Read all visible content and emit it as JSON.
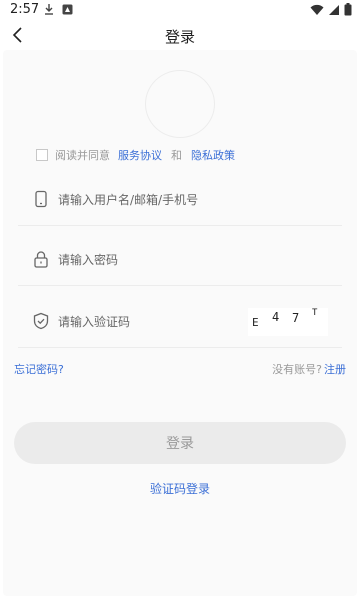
{
  "status_bar": {
    "time": "2:57",
    "left_icons": [
      "download-icon",
      "notification-app-icon"
    ],
    "right_icons": [
      "wifi-icon",
      "signal-icon",
      "battery-icon"
    ]
  },
  "header": {
    "title": "登录",
    "back_icon": "chevron-left-icon"
  },
  "agreement": {
    "prefix": "阅读并同意",
    "service_link": "服务协议",
    "and": "和",
    "privacy_link": "隐私政策",
    "checked": false
  },
  "fields": {
    "username": {
      "placeholder": "请输入用户名/邮箱/手机号",
      "value": "",
      "icon": "phone-icon"
    },
    "password": {
      "placeholder": "请输入密码",
      "value": "",
      "icon": "lock-icon"
    },
    "captcha": {
      "placeholder": "请输入验证码",
      "value": "",
      "icon": "shield-check-icon",
      "captcha_text": [
        "E",
        "4",
        "7",
        "T"
      ]
    }
  },
  "links": {
    "forgot_password": "忘记密码?",
    "no_account": "没有账号?",
    "register": "注册"
  },
  "buttons": {
    "login": "登录",
    "code_login": "验证码登录"
  },
  "colors": {
    "accent": "#3b6fd6",
    "button_bg": "#ebebeb",
    "button_text": "#9a9a9a"
  }
}
